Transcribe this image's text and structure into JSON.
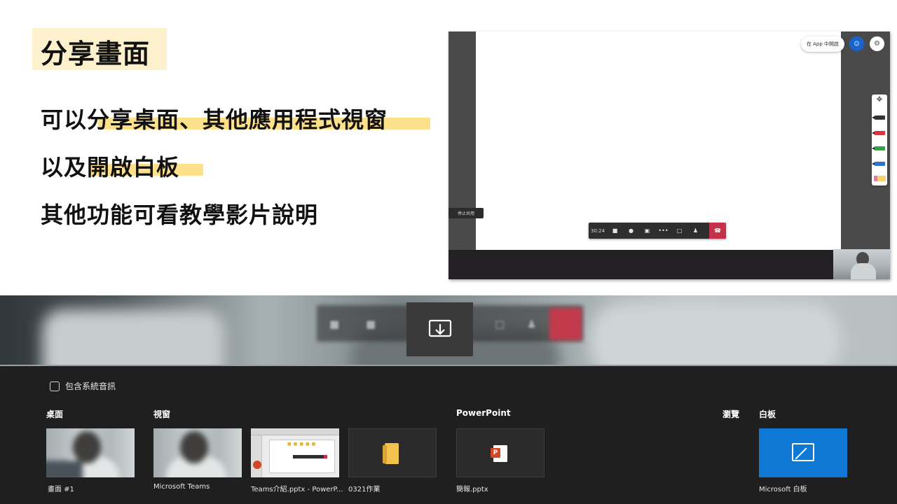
{
  "slide": {
    "title": "分享畫面",
    "line1": "可以分享桌面、其他應用程式視窗",
    "line2": "以及開啟白板",
    "line3": "其他功能可看教學影片說明"
  },
  "teams_screenshot": {
    "open_in_app": "在 App 中開啟",
    "stop_sharing": "停止共用",
    "call_time": "30:24"
  },
  "share_tray": {
    "include_audio": "包含系統音訊",
    "sections": {
      "desktop": "桌面",
      "window": "視窗",
      "powerpoint": "PowerPoint",
      "browse": "瀏覽",
      "whiteboard": "白板"
    },
    "items": {
      "screen1": "畫面 #1",
      "teams": "Microsoft Teams",
      "teams_ppt": "Teams介紹.pptx - PowerP...",
      "folder": "0321作業",
      "pptx": "簡報.pptx",
      "whiteboard": "Microsoft 白板"
    }
  },
  "colors": {
    "highlight": "#fde08a",
    "title_bg": "#fdf0cc",
    "end_call": "#c4314b",
    "whiteboard_blue": "#0f78d4",
    "tray_bg": "#1f1f1f"
  }
}
